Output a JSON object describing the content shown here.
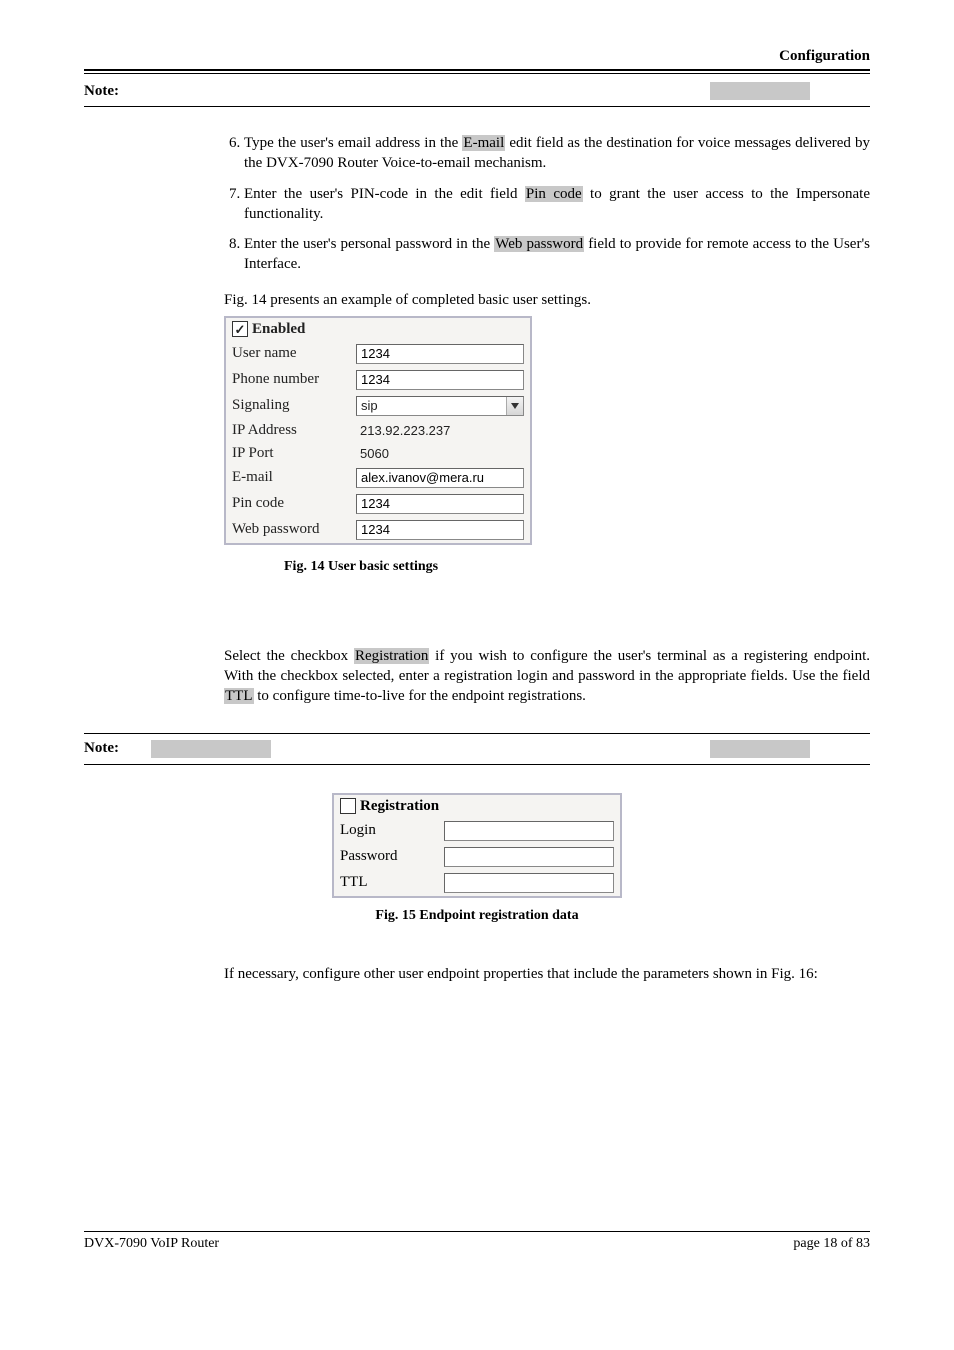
{
  "header": {
    "section": "Configuration"
  },
  "note1": {
    "label": "Note:"
  },
  "steps": {
    "s6": {
      "pre": "Type the user's email address in the ",
      "hl": "E-mail",
      "post": " edit field as the destination for voice messages delivered by the DVX-7090 Router Voice-to-email mechanism."
    },
    "s7": {
      "pre": "Enter the user's PIN-code in the edit field ",
      "hl": "Pin code",
      "post": " to grant the user access to the Impersonate functionality."
    },
    "s8": {
      "pre": "Enter the user's personal password in the ",
      "hl": "Web password",
      "post": " field to provide for remote access to the User's Interface."
    }
  },
  "fig14_intro": "Fig. 14 presents an example of completed basic user settings.",
  "settings": {
    "enabled_label": "Enabled",
    "enabled_check": "✓",
    "rows": {
      "user_name": {
        "label": "User name",
        "value": "1234"
      },
      "phone": {
        "label": "Phone number",
        "value": "1234"
      },
      "signaling": {
        "label": "Signaling",
        "value": "sip"
      },
      "ip_addr": {
        "label": "IP Address",
        "value": "213.92.223.237"
      },
      "ip_port": {
        "label": "IP Port",
        "value": "5060"
      },
      "email": {
        "label": "E-mail",
        "value": "alex.ivanov@mera.ru"
      },
      "pin": {
        "label": "Pin code",
        "value": "1234"
      },
      "webpass": {
        "label": "Web password",
        "value": "1234"
      }
    }
  },
  "fig14_caption": "Fig. 14 User basic settings",
  "reg_para": {
    "pre": "Select the checkbox ",
    "hl1": "Registration",
    "mid": " if you wish to configure the user's terminal as a registering endpoint. With the checkbox selected, enter a registration login and password in the appropriate fields. Use the field ",
    "hl2": "TTL",
    "post": " to configure time-to-live for the endpoint registrations."
  },
  "note2": {
    "label": "Note:"
  },
  "reg_table": {
    "title": "Registration",
    "login": "Login",
    "password": "Password",
    "ttl": "TTL"
  },
  "fig15_caption": "Fig. 15 Endpoint registration data",
  "closing_para": "If necessary, configure other user endpoint properties that include the parameters shown in Fig. 16:",
  "footer": {
    "left": "DVX-7090 VoIP Router",
    "right": "page 18 of 83"
  }
}
